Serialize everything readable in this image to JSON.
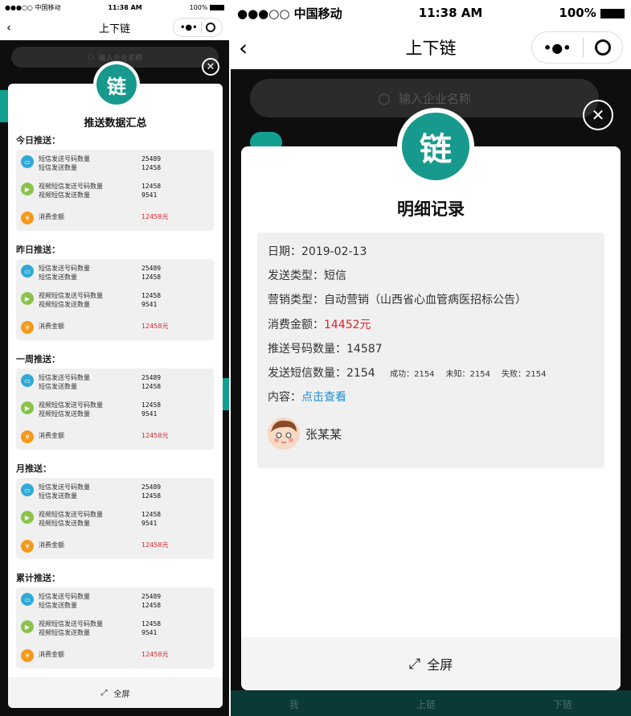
{
  "left": {
    "status": {
      "carrier": "●●●○○ 中国移动",
      "time": "11:38 AM",
      "battery": "100%"
    },
    "nav": {
      "title": "上下链"
    },
    "search": {
      "placeholder": "输入企业名称"
    },
    "logo_char": "链",
    "modal_title": "推送数据汇总",
    "sections": [
      {
        "title": "今日推送："
      },
      {
        "title": "昨日推送："
      },
      {
        "title": "一周推送："
      },
      {
        "title": "月推送："
      },
      {
        "title": "累计推送："
      }
    ],
    "card": {
      "sms_label_1": "短信发送号码数量",
      "sms_label_2": "短信发送数量",
      "sms_value_1": "25489",
      "sms_value_2": "12458",
      "video_label_1": "视频短信发送号码数量",
      "video_label_2": "视频短信发送数量",
      "video_value_1": "12458",
      "video_value_2": "9541",
      "spend_label": "消费金额",
      "spend_value": "12458元"
    },
    "footer_label": "全屏"
  },
  "right": {
    "status": {
      "carrier": "●●●○○ 中国移动",
      "time": "11:38 AM",
      "battery": "100%"
    },
    "nav": {
      "title": "上下链"
    },
    "search": {
      "placeholder": "输入企业名称"
    },
    "logo_char": "链",
    "modal_title": "明细记录",
    "detail": {
      "date": "日期：2019-02-13",
      "send_type": "发送类型：短信",
      "marketing_type": "营销类型：自动营销（山西省心血管病医招标公告）",
      "spend_prefix": "消费金额：",
      "spend_value": "14452元",
      "push_count": "推送号码数量：14587",
      "sms_count": "发送短信数量：2154",
      "success": "成功：2154",
      "unknown": "未知：2154",
      "fail": "失败：2154",
      "content_prefix": "内容：",
      "content_link": "点击查看",
      "user_name": "张某某"
    },
    "footer_label": "全屏",
    "tabbar": [
      "我",
      "上链",
      "下链"
    ]
  },
  "colors": {
    "brand": "#17998d",
    "money": "#d8252b",
    "link": "#1a8fd6"
  }
}
